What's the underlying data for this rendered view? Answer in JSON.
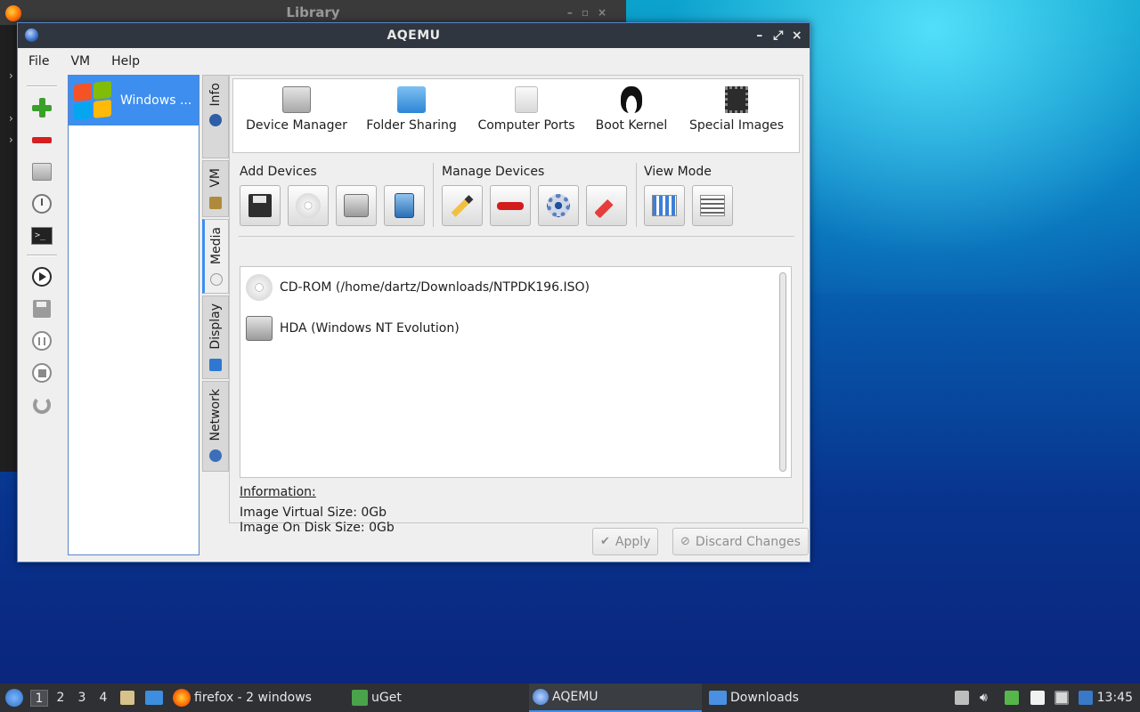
{
  "background_window": {
    "title": "Library"
  },
  "window": {
    "title": "AQEMU"
  },
  "menu": {
    "file": "File",
    "vm": "VM",
    "help": "Help"
  },
  "vm_list": [
    {
      "name": "Windows ..."
    }
  ],
  "tabs": {
    "info": "Info",
    "vm": "VM",
    "media": "Media",
    "display": "Display",
    "network": "Network"
  },
  "categories": {
    "device_manager": "Device Manager",
    "folder_sharing": "Folder Sharing",
    "computer_ports": "Computer Ports",
    "boot_kernel": "Boot Kernel",
    "special_images": "Special Images"
  },
  "groups": {
    "add": "Add Devices",
    "manage": "Manage Devices",
    "view": "View Mode"
  },
  "devices": [
    {
      "label": "CD-ROM (/home/dartz/Downloads/NTPDK196.ISO)",
      "icon": "cdrom-icon"
    },
    {
      "label": "HDA (Windows NT Evolution)",
      "icon": "hdd-icon"
    }
  ],
  "information": {
    "heading": "Information:",
    "virtual_size": "Image Virtual Size: 0Gb",
    "on_disk_size": "Image On Disk Size: 0Gb"
  },
  "buttons": {
    "apply": "Apply",
    "discard": "Discard Changes"
  },
  "taskbar": {
    "workspaces": [
      "1",
      "2",
      "3",
      "4"
    ],
    "firefox": "firefox - 2 windows",
    "uget": "uGet",
    "aqemu": "AQEMU",
    "downloads": "Downloads",
    "clock": "13:45"
  },
  "colors": {
    "accent": "#3e8ef0",
    "titlebar": "#2f3640",
    "taskbar": "#2e3033"
  }
}
